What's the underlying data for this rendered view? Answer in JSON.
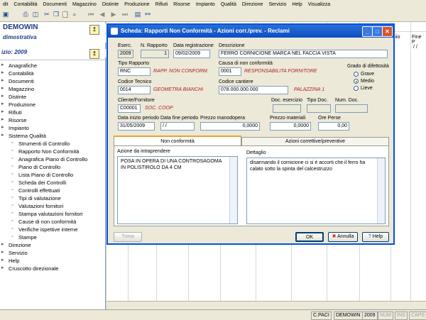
{
  "menubar": {
    "items": [
      "dit",
      "Contabilità",
      "Documenti",
      "Magazzino",
      "Distinte",
      "Produzione",
      "Rifiuti",
      "Risorse",
      "Impianto",
      "Qualità",
      "Direzione",
      "Servizio",
      "Help",
      "Visualizza"
    ]
  },
  "leftpane": {
    "company": "DEMOWIN",
    "subtitle": "dimostrativa",
    "year_label": "izio: 2009",
    "tree": [
      "Anagrafiche",
      "Contabilità",
      "Documenti",
      "Magazzino",
      "Distinte",
      "Produzione",
      "Rifiuti",
      "Risorse",
      "Impianto",
      "Sistema Qualità",
      "Strumenti di Controllo",
      "Rapporto Non Conformità",
      "Anagrafica Piano di Controllo",
      "Piano di Controllo",
      "Lista Piano di Controllo",
      "Scheda dei Controlli",
      "Controlli effettuati",
      "Tipi di valutazione",
      "Valutazioni fornitori",
      "Stampa valutazioni fornitori",
      "Cause di non conformità",
      "Verifiche ispettive interne",
      "Stampe",
      "Direzione",
      "Servizio",
      "Help",
      "Cruscotto direzionale"
    ]
  },
  "grid": {
    "col_header_1": "ziio",
    "col_header_2": "Fine P",
    "cell_1": "/ /"
  },
  "dialog": {
    "title": "Scheda: Rapporti Non Conformità - Azioni corr./prev. - Reclami",
    "esercizio_label": "Eserc.",
    "esercizio": "2009",
    "nrapporto_label": "N. Rapporto",
    "nrapporto": "1",
    "data_reg_label": "Data registrazione",
    "data_reg": "09/02/2009",
    "descrizione_label": "Descrizione",
    "descrizione": "FERRO CORNICIONE MARCA NEL FACCIA VISTA",
    "tipo_rapporto_label": "Tipo Rapporto",
    "tipo_rapporto": "RNC",
    "tipo_rapporto_desc": "RAPP. NON CONFORM.",
    "causa_label": "Causa di non conformità",
    "causa_code": "0001",
    "causa_desc": "RESPONSABILITA FORNITORE",
    "grado_label": "Grado di difettosità",
    "grado_options": [
      "Grave",
      "Medio",
      "Lieve"
    ],
    "grado_selected": "Medio",
    "tecnico_label": "Codice Tecnico",
    "tecnico_code": "0014",
    "tecnico_desc": "GEOMETRA BIANCHI",
    "cantiere_label": "Codice cantiere",
    "cantiere_code": "078.000.000.000",
    "cantiere_desc": "PALAZZINA 1",
    "cliente_label": "Cliente/Fornitore",
    "cliente_code": "C00001",
    "cliente_desc": "SOC. COOP",
    "doc_esercizio_label": "Doc. esercizio",
    "tipo_doc_label": "Tipo Doc.",
    "num_doc_label": "Num. Doc.",
    "data_inizio_label": "Data inizio periodo",
    "data_inizio": "31/05/2009",
    "data_fine_label": "Data fine periodo",
    "data_fine": "/ /",
    "prezzo_mano_label": "Prezzo manodopera",
    "prezzo_mano": "0,0000",
    "prezzo_mat_label": "Prezzo materiali",
    "prezzo_mat": "0,0000",
    "ore_perse_label": "Ore Perse",
    "ore_perse": "0,00",
    "tabs": [
      "Non conformità",
      "Azioni correttive/preventive"
    ],
    "azione_label": "Azione da intraprendere",
    "azione_text": "POSA IN OPERA DI UNA CONTROSAGOMA IN POLISTIROLO DA 4 CM",
    "dettaglio_label": "Dettaglio",
    "dettaglio_text": "disarmando il cornicione ci si è accorti che il ferro ha calato sotto la spinta del calcestruzzo",
    "btn_trova": "Trova",
    "btn_ok": "OK",
    "btn_annulla": "Annulla",
    "btn_help": "Help"
  },
  "statusbar": {
    "user": "C.PACI",
    "company": "DEMOWIN",
    "year": "2009",
    "num": "NUM",
    "ins": "INS",
    "caps": "CAPS"
  },
  "colors": {
    "titlebar": "#0a4ec4",
    "accent_red": "#b02020",
    "tab_active": "#f0a030"
  }
}
